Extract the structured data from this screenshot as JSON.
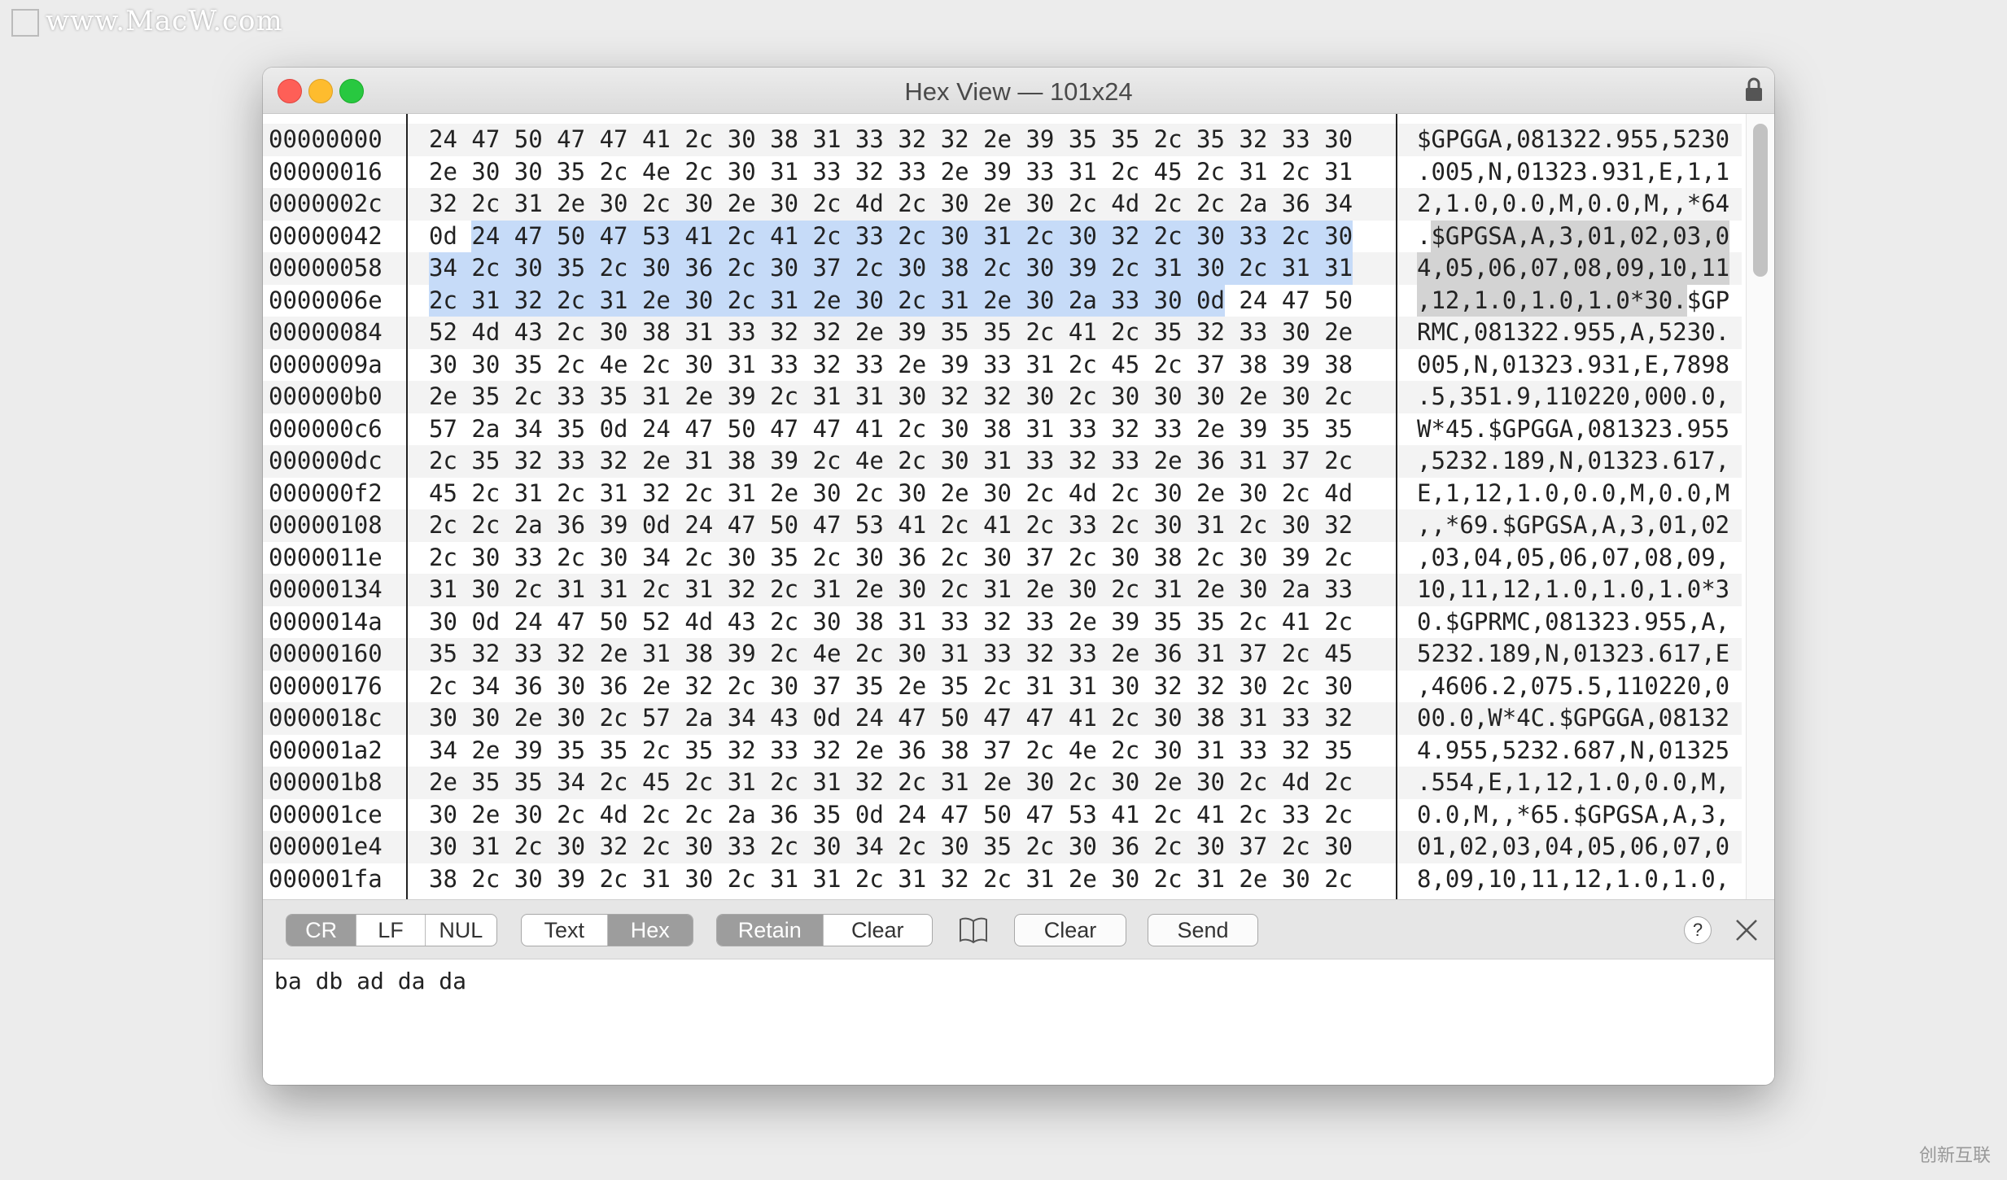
{
  "watermark": "www.MacW.com",
  "corner_logo": "创新互联",
  "window": {
    "title": "Hex View — 101x24"
  },
  "colors": {
    "hex_selection": "#c6dbf8",
    "ascii_selection": "#d3d3d3",
    "toggle_on": "#9d9d9d"
  },
  "selection": {
    "first_byte": 67,
    "last_byte": 128
  },
  "rows": [
    {
      "offset": "00000000",
      "hex": "24 47 50 47 47 41 2c 30 38 31 33 32 32 2e 39 35 35 2c 35 32 33 30",
      "ascii": "$GPGGA,081322.955,5230"
    },
    {
      "offset": "00000016",
      "hex": "2e 30 30 35 2c 4e 2c 30 31 33 32 33 2e 39 33 31 2c 45 2c 31 2c 31",
      "ascii": ".005,N,01323.931,E,1,1"
    },
    {
      "offset": "0000002c",
      "hex": "32 2c 31 2e 30 2c 30 2e 30 2c 4d 2c 30 2e 30 2c 4d 2c 2c 2a 36 34",
      "ascii": "2,1.0,0.0,M,0.0,M,,*64"
    },
    {
      "offset": "00000042",
      "hex": "0d 24 47 50 47 53 41 2c 41 2c 33 2c 30 31 2c 30 32 2c 30 33 2c 30",
      "ascii": ".$GPGSA,A,3,01,02,03,0"
    },
    {
      "offset": "00000058",
      "hex": "34 2c 30 35 2c 30 36 2c 30 37 2c 30 38 2c 30 39 2c 31 30 2c 31 31",
      "ascii": "4,05,06,07,08,09,10,11"
    },
    {
      "offset": "0000006e",
      "hex": "2c 31 32 2c 31 2e 30 2c 31 2e 30 2c 31 2e 30 2a 33 30 0d 24 47 50",
      "ascii": ",12,1.0,1.0,1.0*30.$GP"
    },
    {
      "offset": "00000084",
      "hex": "52 4d 43 2c 30 38 31 33 32 32 2e 39 35 35 2c 41 2c 35 32 33 30 2e",
      "ascii": "RMC,081322.955,A,5230."
    },
    {
      "offset": "0000009a",
      "hex": "30 30 35 2c 4e 2c 30 31 33 32 33 2e 39 33 31 2c 45 2c 37 38 39 38",
      "ascii": "005,N,01323.931,E,7898"
    },
    {
      "offset": "000000b0",
      "hex": "2e 35 2c 33 35 31 2e 39 2c 31 31 30 32 32 30 2c 30 30 30 2e 30 2c",
      "ascii": ".5,351.9,110220,000.0,"
    },
    {
      "offset": "000000c6",
      "hex": "57 2a 34 35 0d 24 47 50 47 47 41 2c 30 38 31 33 32 33 2e 39 35 35",
      "ascii": "W*45.$GPGGA,081323.955"
    },
    {
      "offset": "000000dc",
      "hex": "2c 35 32 33 32 2e 31 38 39 2c 4e 2c 30 31 33 32 33 2e 36 31 37 2c",
      "ascii": ",5232.189,N,01323.617,"
    },
    {
      "offset": "000000f2",
      "hex": "45 2c 31 2c 31 32 2c 31 2e 30 2c 30 2e 30 2c 4d 2c 30 2e 30 2c 4d",
      "ascii": "E,1,12,1.0,0.0,M,0.0,M"
    },
    {
      "offset": "00000108",
      "hex": "2c 2c 2a 36 39 0d 24 47 50 47 53 41 2c 41 2c 33 2c 30 31 2c 30 32",
      "ascii": ",,*69.$GPGSA,A,3,01,02"
    },
    {
      "offset": "0000011e",
      "hex": "2c 30 33 2c 30 34 2c 30 35 2c 30 36 2c 30 37 2c 30 38 2c 30 39 2c",
      "ascii": ",03,04,05,06,07,08,09,"
    },
    {
      "offset": "00000134",
      "hex": "31 30 2c 31 31 2c 31 32 2c 31 2e 30 2c 31 2e 30 2c 31 2e 30 2a 33",
      "ascii": "10,11,12,1.0,1.0,1.0*3"
    },
    {
      "offset": "0000014a",
      "hex": "30 0d 24 47 50 52 4d 43 2c 30 38 31 33 32 33 2e 39 35 35 2c 41 2c",
      "ascii": "0.$GPRMC,081323.955,A,"
    },
    {
      "offset": "00000160",
      "hex": "35 32 33 32 2e 31 38 39 2c 4e 2c 30 31 33 32 33 2e 36 31 37 2c 45",
      "ascii": "5232.189,N,01323.617,E"
    },
    {
      "offset": "00000176",
      "hex": "2c 34 36 30 36 2e 32 2c 30 37 35 2e 35 2c 31 31 30 32 32 30 2c 30",
      "ascii": ",4606.2,075.5,110220,0"
    },
    {
      "offset": "0000018c",
      "hex": "30 30 2e 30 2c 57 2a 34 43 0d 24 47 50 47 47 41 2c 30 38 31 33 32",
      "ascii": "00.0,W*4C.$GPGGA,08132"
    },
    {
      "offset": "000001a2",
      "hex": "34 2e 39 35 35 2c 35 32 33 32 2e 36 38 37 2c 4e 2c 30 31 33 32 35",
      "ascii": "4.955,5232.687,N,01325"
    },
    {
      "offset": "000001b8",
      "hex": "2e 35 35 34 2c 45 2c 31 2c 31 32 2c 31 2e 30 2c 30 2e 30 2c 4d 2c",
      "ascii": ".554,E,1,12,1.0,0.0,M,"
    },
    {
      "offset": "000001ce",
      "hex": "30 2e 30 2c 4d 2c 2c 2a 36 35 0d 24 47 50 47 53 41 2c 41 2c 33 2c",
      "ascii": "0.0,M,,*65.$GPGSA,A,3,"
    },
    {
      "offset": "000001e4",
      "hex": "30 31 2c 30 32 2c 30 33 2c 30 34 2c 30 35 2c 30 36 2c 30 37 2c 30",
      "ascii": "01,02,03,04,05,06,07,0"
    },
    {
      "offset": "000001fa",
      "hex": "38 2c 30 39 2c 31 30 2c 31 31 2c 31 32 2c 31 2e 30 2c 31 2e 30 2c",
      "ascii": "8,09,10,11,12,1.0,1.0,"
    }
  ],
  "toolbar": {
    "line_ending": {
      "cr": "CR",
      "lf": "LF",
      "nul": "NUL",
      "selected": "CR"
    },
    "mode": {
      "text": "Text",
      "hex": "Hex",
      "selected": "Hex"
    },
    "retain": {
      "retain": "Retain",
      "clear": "Clear",
      "selected": "Retain"
    },
    "clear_label": "Clear",
    "send_label": "Send",
    "help_label": "?"
  },
  "input": {
    "value": "ba db ad da da"
  }
}
